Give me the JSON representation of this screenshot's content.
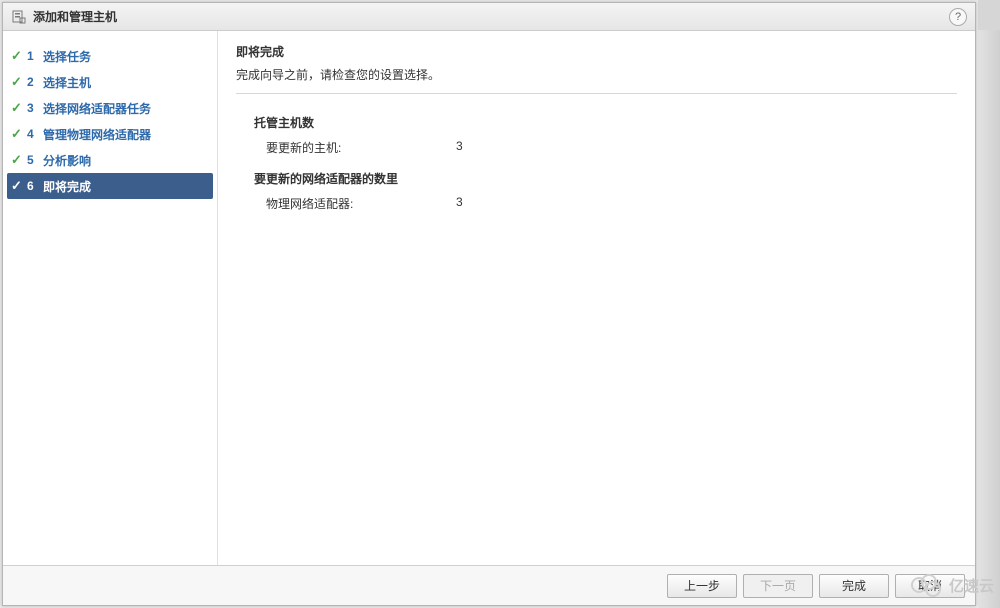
{
  "titlebar": {
    "title": "添加和管理主机",
    "help": "?"
  },
  "sidebar": {
    "steps": [
      {
        "num": "1",
        "label": "选择任务",
        "done": true
      },
      {
        "num": "2",
        "label": "选择主机",
        "done": true
      },
      {
        "num": "3",
        "label": "选择网络适配器任务",
        "done": true
      },
      {
        "num": "4",
        "label": "管理物理网络适配器",
        "done": true
      },
      {
        "num": "5",
        "label": "分析影响",
        "done": true
      },
      {
        "num": "6",
        "label": "即将完成",
        "done": false,
        "active": true
      }
    ]
  },
  "content": {
    "title": "即将完成",
    "subtitle": "完成向导之前，请检查您的设置选择。",
    "section1": {
      "header": "托管主机数",
      "row_label": "要更新的主机:",
      "row_value": "3"
    },
    "section2": {
      "header": "要更新的网络适配器的数里",
      "row_label": "物理网络适配器:",
      "row_value": "3"
    }
  },
  "footer": {
    "back": "上一步",
    "next": "下一页",
    "finish": "完成",
    "cancel": "取消"
  },
  "watermark": "亿速云"
}
